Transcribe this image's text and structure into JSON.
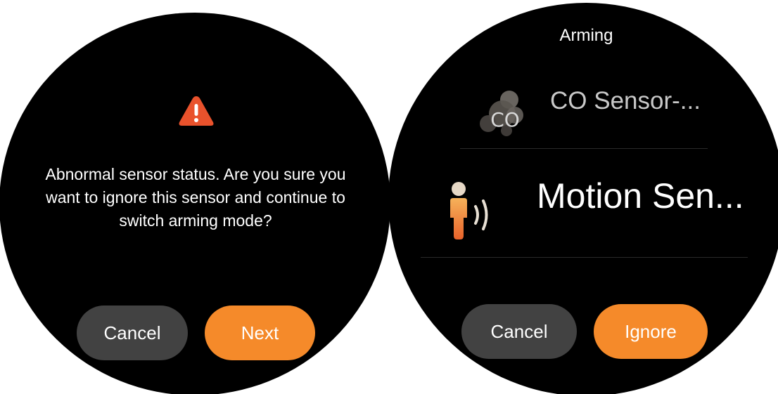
{
  "left_screen": {
    "warning_icon": "warning-triangle-icon",
    "message": "Abnormal sensor status. Are you sure you want to ignore this sensor and continue to switch arming mode?",
    "cancel_label": "Cancel",
    "next_label": "Next"
  },
  "right_screen": {
    "title": "Arming",
    "sensors": [
      {
        "label": "CO Sensor-...",
        "icon": "co-sensor-icon",
        "icon_text": "CO"
      },
      {
        "label": "Motion Sen...",
        "icon": "motion-sensor-icon"
      }
    ],
    "cancel_label": "Cancel",
    "ignore_label": "Ignore"
  },
  "colors": {
    "accent": "#f58a2a",
    "secondary_button": "#424242",
    "warning": "#e9522c",
    "background": "#000000"
  }
}
